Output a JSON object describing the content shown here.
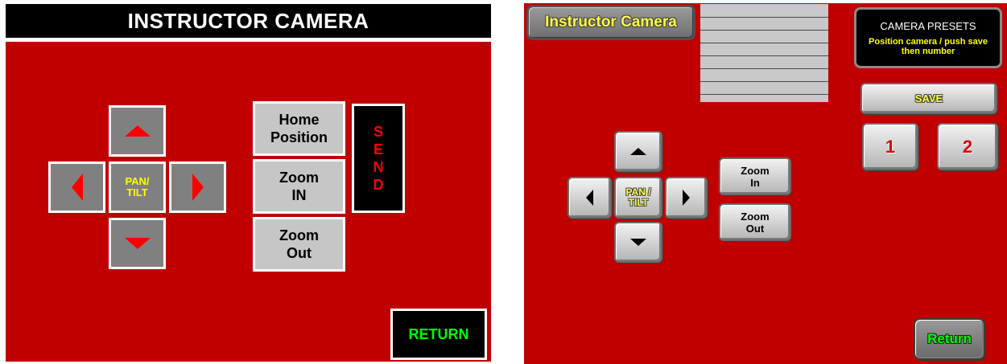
{
  "left_screen": {
    "title": "INSTRUCTOR CAMERA",
    "pan_tilt_label": [
      "PAN/",
      "TILT"
    ],
    "home_position_label": [
      "Home",
      "Position"
    ],
    "zoom_in_label": [
      "Zoom",
      "IN"
    ],
    "zoom_out_label": [
      "Zoom",
      "Out"
    ],
    "send_letters": [
      "S",
      "E",
      "N",
      "D"
    ],
    "return_label": "RETURN"
  },
  "right_screen": {
    "title_button_label": "Instructor Camera",
    "presets_title": "CAMERA PRESETS",
    "presets_instructions": [
      "Position camera / push save",
      "then number"
    ],
    "save_label": "SAVE",
    "preset_1_label": "1",
    "preset_2_label": "2",
    "pan_tilt_label": [
      "PAN /",
      "TILT"
    ],
    "zoom_in_label": [
      "Zoom",
      "In"
    ],
    "zoom_out_label": [
      "Zoom",
      "Out"
    ],
    "return_label": "Return"
  },
  "colors": {
    "panel_red": "#c00000",
    "send_text": "#ff0000",
    "return_text_left": "#00ff00",
    "pan_tilt_text": "#ffff00"
  }
}
